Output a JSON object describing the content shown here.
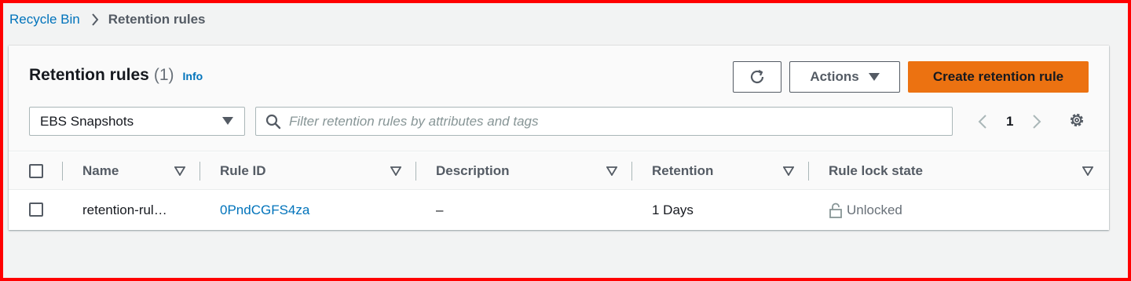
{
  "breadcrumb": {
    "root": "Recycle Bin",
    "current": "Retention rules"
  },
  "header": {
    "title": "Retention rules",
    "count": "(1)",
    "info": "Info"
  },
  "toolbar": {
    "refresh_icon": "refresh-icon",
    "actions_label": "Actions",
    "create_label": "Create retention rule"
  },
  "filter": {
    "resource_type": "EBS Snapshots",
    "search_placeholder": "Filter retention rules by attributes and tags"
  },
  "pagination": {
    "current_page": "1"
  },
  "table": {
    "columns": [
      "Name",
      "Rule ID",
      "Description",
      "Retention",
      "Rule lock state"
    ],
    "rows": [
      {
        "name": "retention-rul…",
        "rule_id": "0PndCGFS4za",
        "description": "–",
        "retention": "1 Days",
        "lock_state": "Unlocked"
      }
    ]
  },
  "colors": {
    "link": "#0073bb",
    "primary": "#ec7211",
    "frame": "#ff0000"
  }
}
